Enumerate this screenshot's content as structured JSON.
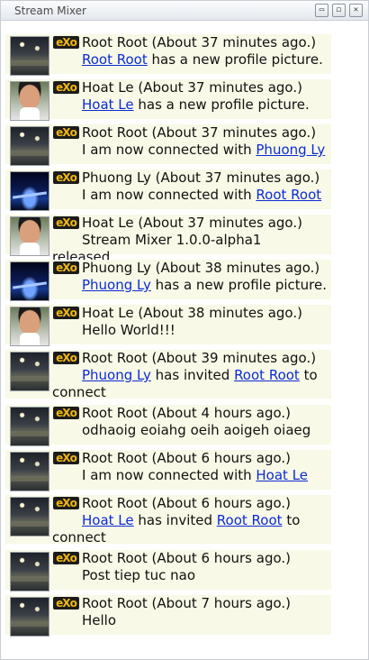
{
  "window": {
    "title": "Stream Mixer",
    "controls": {
      "minimize": "▭",
      "maximize": "◻",
      "close": "✕"
    }
  },
  "activities": [
    {
      "user": "Root Root",
      "time": "(About 37 minutes ago.)",
      "avatar": "root",
      "segments": [
        {
          "text": "Root Root",
          "link": true
        },
        {
          "text": " has a new profile picture.",
          "link": false
        }
      ]
    },
    {
      "user": "Hoat Le",
      "time": "(About 37 minutes ago.)",
      "avatar": "hoat",
      "segments": [
        {
          "text": "Hoat Le",
          "link": true
        },
        {
          "text": " has a new profile picture.",
          "link": false
        }
      ]
    },
    {
      "user": "Root Root",
      "time": "(About 37 minutes ago.)",
      "avatar": "root",
      "segments": [
        {
          "text": "I am now connected with ",
          "link": false
        },
        {
          "text": "Phuong Ly",
          "link": true
        }
      ]
    },
    {
      "user": "Phuong Ly",
      "time": "(About 37 minutes ago.)",
      "avatar": "phuong",
      "segments": [
        {
          "text": "I am now connected with ",
          "link": false
        },
        {
          "text": "Root Root",
          "link": true
        }
      ]
    },
    {
      "user": "Hoat Le",
      "time": "(About 37 minutes ago.)",
      "avatar": "hoat",
      "segments": [
        {
          "text": "Stream Mixer 1.0.0-alpha1 released...",
          "link": false
        }
      ]
    },
    {
      "user": "Phuong Ly",
      "time": "(About 38 minutes ago.)",
      "avatar": "phuong",
      "segments": [
        {
          "text": "Phuong Ly",
          "link": true
        },
        {
          "text": " has a new profile picture.",
          "link": false
        }
      ]
    },
    {
      "user": "Hoat Le",
      "time": "(About 38 minutes ago.)",
      "avatar": "hoat",
      "segments": [
        {
          "text": "Hello World!!!",
          "link": false
        }
      ]
    },
    {
      "user": "Root Root",
      "time": "(About 39 minutes ago.)",
      "avatar": "root",
      "segments": [
        {
          "text": "Phuong Ly",
          "link": true
        },
        {
          "text": " has invited ",
          "link": false
        },
        {
          "text": "Root Root",
          "link": true
        },
        {
          "text": " to connect",
          "link": false
        }
      ]
    },
    {
      "user": "Root Root",
      "time": "(About 4 hours ago.)",
      "avatar": "root",
      "segments": [
        {
          "text": "odhaoig eoiahg oeih aoigeh oiaeg",
          "link": false
        }
      ]
    },
    {
      "user": "Root Root",
      "time": "(About 6 hours ago.)",
      "avatar": "root",
      "segments": [
        {
          "text": "I am now connected with ",
          "link": false
        },
        {
          "text": "Hoat Le",
          "link": true
        }
      ]
    },
    {
      "user": "Root Root",
      "time": "(About 6 hours ago.)",
      "avatar": "root",
      "segments": [
        {
          "text": "Hoat Le",
          "link": true
        },
        {
          "text": " has invited ",
          "link": false
        },
        {
          "text": "Root Root",
          "link": true
        },
        {
          "text": " to connect",
          "link": false
        }
      ]
    },
    {
      "user": "Root Root",
      "time": "(About 6 hours ago.)",
      "avatar": "root",
      "segments": [
        {
          "text": "Post tiep tuc nao",
          "link": false
        }
      ]
    },
    {
      "user": "Root Root",
      "time": "(About 7 hours ago.)",
      "avatar": "root",
      "segments": [
        {
          "text": "Hello",
          "link": false
        }
      ]
    }
  ],
  "app_badge": "eXo"
}
